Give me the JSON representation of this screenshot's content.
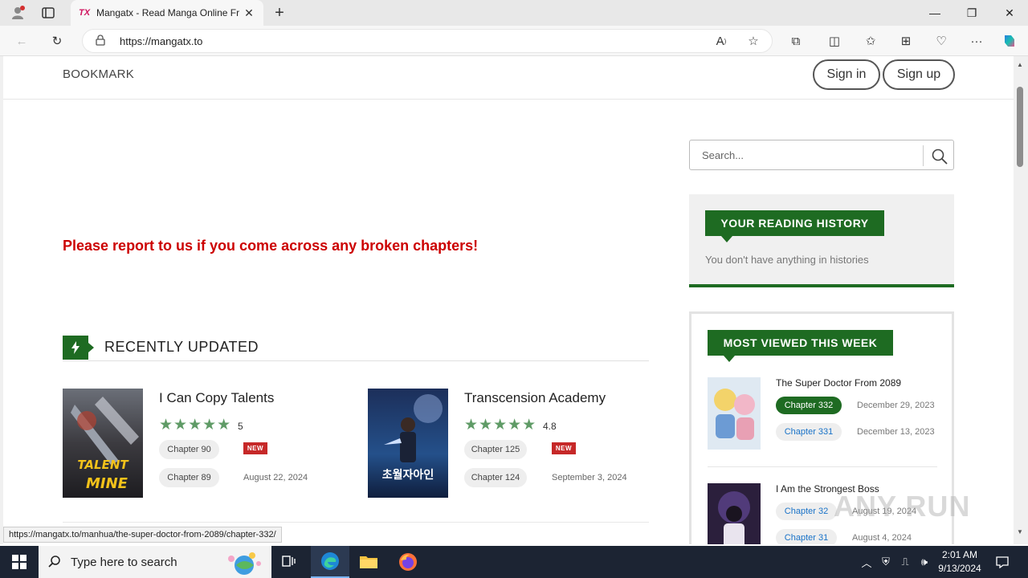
{
  "browser": {
    "tab_title": "Mangatx - Read Manga Online Fr",
    "tab_favicon": "TX",
    "url": "https://mangatx.to",
    "status_url": "https://mangatx.to/manhua/the-super-doctor-from-2089/chapter-332/"
  },
  "header": {
    "bookmark": "BOOKMARK",
    "sign_in": "Sign in",
    "sign_up": "Sign up"
  },
  "main": {
    "report_notice": "Please report to us if you come across any broken chapters!",
    "section_title": "RECENTLY UPDATED",
    "manga": [
      {
        "title": "I Can Copy Talents",
        "stars": "★★★★★",
        "rating": "5",
        "chapters": [
          {
            "label": "Chapter 90",
            "badge": "NEW"
          },
          {
            "label": "Chapter 89",
            "date": "August 22, 2024"
          }
        ],
        "cover_text": "TALENT"
      },
      {
        "title": "Transcension Academy",
        "stars": "★★★★★",
        "rating": "4.8",
        "chapters": [
          {
            "label": "Chapter 125",
            "badge": "NEW"
          },
          {
            "label": "Chapter 124",
            "date": "September 3, 2024"
          }
        ],
        "cover_text": "초월자아인"
      }
    ]
  },
  "sidebar": {
    "search_placeholder": "Search...",
    "history_title": "YOUR READING HISTORY",
    "history_empty": "You don't have anything in histories",
    "most_viewed_title": "MOST VIEWED THIS WEEK",
    "most_viewed": [
      {
        "title": "The Super Doctor From 2089",
        "chapters": [
          {
            "label": "Chapter 332",
            "date": "December 29, 2023",
            "active": true
          },
          {
            "label": "Chapter 331",
            "date": "December 13, 2023",
            "active": false
          }
        ]
      },
      {
        "title": "I Am the Strongest Boss",
        "chapters": [
          {
            "label": "Chapter 32",
            "date": "August 19, 2024",
            "active": false
          },
          {
            "label": "Chapter 31",
            "date": "August 4, 2024",
            "active": false
          }
        ]
      }
    ]
  },
  "taskbar": {
    "search_placeholder": "Type here to search",
    "time": "2:01 AM",
    "date": "9/13/2024"
  },
  "watermark": "ANY RUN",
  "colors": {
    "brand_green": "#1e6b22",
    "notice_red": "#cc0000",
    "star_green": "#5f9b66",
    "link_blue": "#1a73c8"
  }
}
